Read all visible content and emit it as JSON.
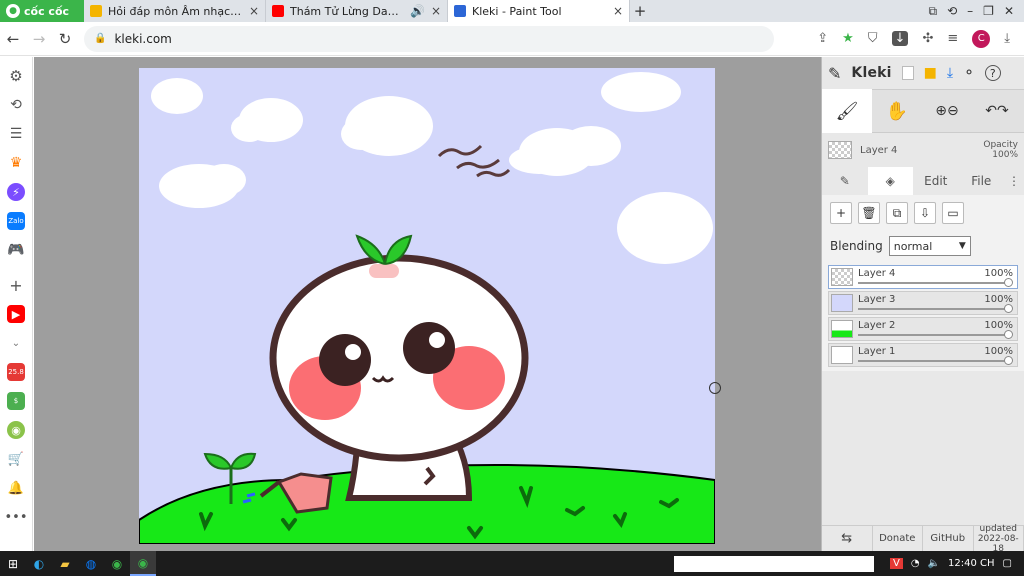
{
  "browser": {
    "brand": "cốc cốc",
    "tabs": [
      {
        "title": "Hỏi đáp môn Âm nhạc, Mỹ thuật",
        "close": "×",
        "color": "#f4b400"
      },
      {
        "title": "Thám Tử Lừng Danh Conan",
        "close": "×",
        "color": "#ff0000"
      },
      {
        "title": "Kleki - Paint Tool",
        "close": "×",
        "color": "#2c66d6"
      }
    ],
    "new_tab": "+",
    "window_buttons": {
      "collapse": "⧉",
      "back_history": "⟲",
      "minimize": "–",
      "restore": "❐",
      "close": "✕"
    },
    "url": "kleki.com",
    "profile_initial": "C"
  },
  "kleki": {
    "title": "Kleki",
    "layer_name": "Layer 4",
    "opacity_label": "Opacity",
    "opacity_value": "100%",
    "tabs": {
      "edit": "Edit",
      "file": "File"
    },
    "blending_label": "Blending",
    "blending_value": "normal",
    "layers": [
      {
        "name": "Layer 4",
        "opacity": "100%",
        "active": true
      },
      {
        "name": "Layer 3",
        "opacity": "100%",
        "active": false
      },
      {
        "name": "Layer 2",
        "opacity": "100%",
        "active": false
      },
      {
        "name": "Layer 1",
        "opacity": "100%",
        "active": false
      }
    ],
    "footer": {
      "donate": "Donate",
      "github": "GitHub",
      "updated_label": "updated",
      "updated_date": "2022-08-18"
    }
  },
  "taskbar": {
    "time": "12:40 CH"
  },
  "colors": {
    "accent": "#3bb54a",
    "canvas_bg": "#d3d7fb",
    "grass": "#17e817"
  }
}
